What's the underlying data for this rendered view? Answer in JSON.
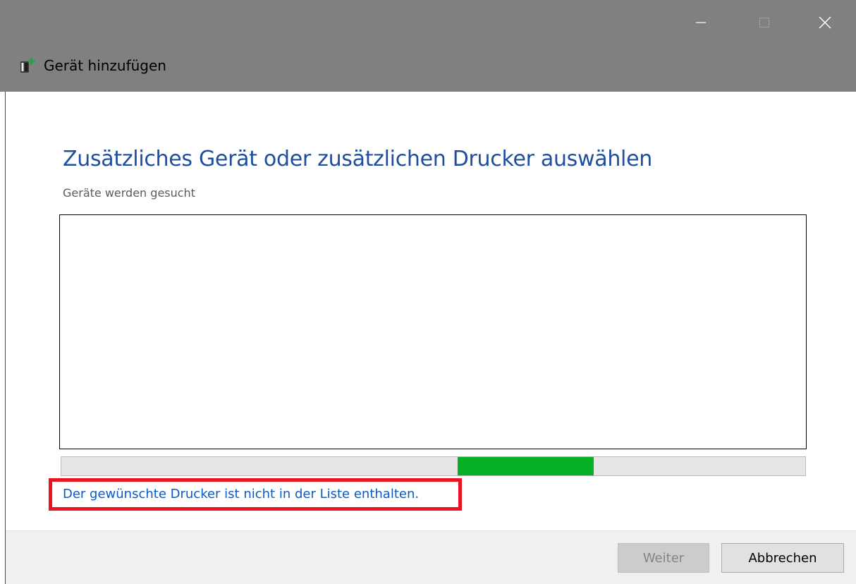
{
  "window": {
    "title": "Gerät hinzufügen",
    "icon": "add-device-icon"
  },
  "caption_buttons": {
    "minimize": "minimize-icon",
    "maximize": "maximize-icon",
    "close": "close-icon"
  },
  "main": {
    "heading": "Zusätzliches Gerät oder zusätzlichen Drucker auswählen",
    "status": "Geräte werden gesucht",
    "device_list_items": [],
    "progress": {
      "indeterminate": true,
      "segment_start_fraction": 0.533,
      "segment_end_fraction": 0.716
    },
    "printer_not_listed_link": "Der gewünschte Drucker ist nicht in der Liste enthalten."
  },
  "footer": {
    "next_label": "Weiter",
    "next_enabled": false,
    "cancel_label": "Abbrechen"
  },
  "colors": {
    "titlebar": "#808080",
    "heading": "#1f4e9e",
    "link": "#0a5bc4",
    "progress": "#06b025",
    "highlight": "#e8141f"
  }
}
